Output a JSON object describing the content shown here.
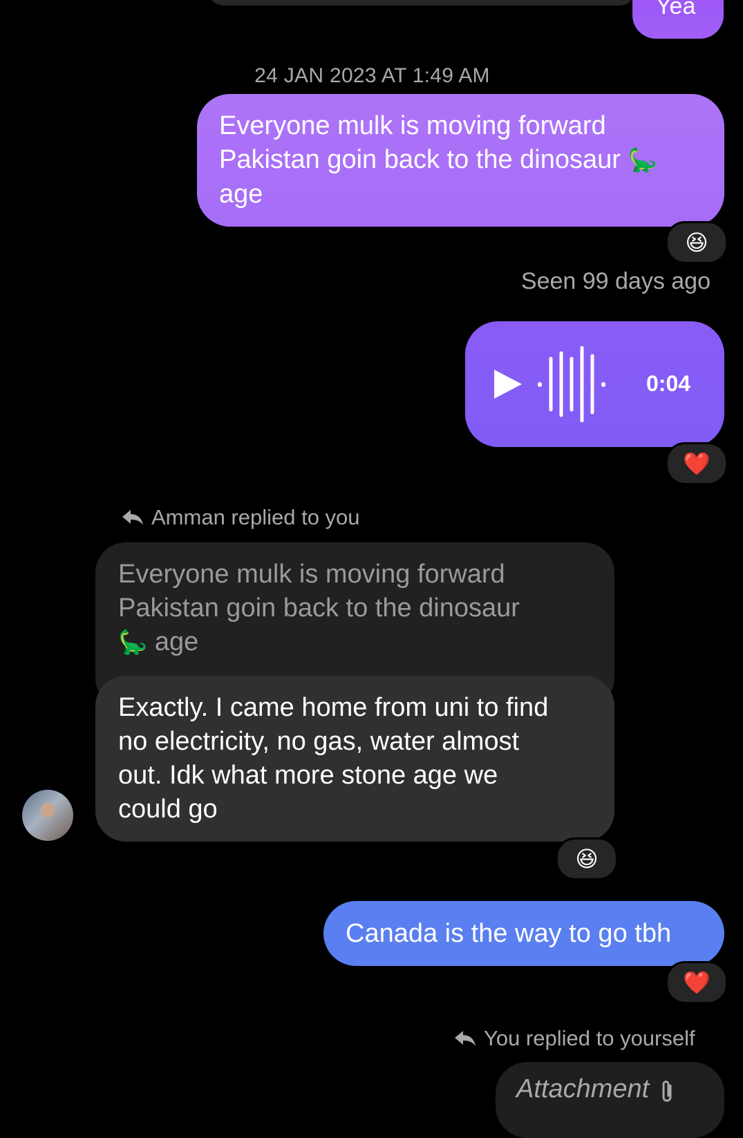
{
  "conversation": {
    "top_reply": "Yea",
    "timestamp": "24 JAN 2023 AT 1:49 AM",
    "messages": {
      "mulk": {
        "line1": "Everyone mulk is moving forward",
        "line2": "Pakistan goin back to the dinosaur",
        "line2_emoji": "🦕",
        "line3": "age",
        "reaction": "😆"
      },
      "seen": "Seen 99 days ago",
      "voice": {
        "duration": "0:04",
        "reaction": "❤️"
      },
      "reply_note_amman": "Amman replied to you",
      "quoted": {
        "line1": "Everyone mulk is moving forward",
        "line2": "Pakistan goin back to the dinosaur",
        "line3_emoji": "🦕",
        "line3": "age"
      },
      "amman_reply": {
        "text": "Exactly. I came home from uni to find\nno electricity, no gas, water almost\nout. Idk what more stone age we\ncould go",
        "reaction": "😆"
      },
      "canada": {
        "text": "Canada is the way to go tbh",
        "reaction": "❤️"
      },
      "reply_note_self": "You replied to yourself",
      "attachment_label": "Attachment"
    }
  },
  "colors": {
    "background": "#000000",
    "my_bubble_purple": "#a66df7",
    "voice_bubble": "#7f5cf5",
    "my_bubble_blue": "#5a7ff0",
    "other_bubble": "#303030",
    "muted_text": "#a9a9a9"
  },
  "icons": {
    "play": "play-icon",
    "waveform": "waveform-icon",
    "reply": "reply-arrow-icon",
    "attachment": "paperclip-icon"
  }
}
